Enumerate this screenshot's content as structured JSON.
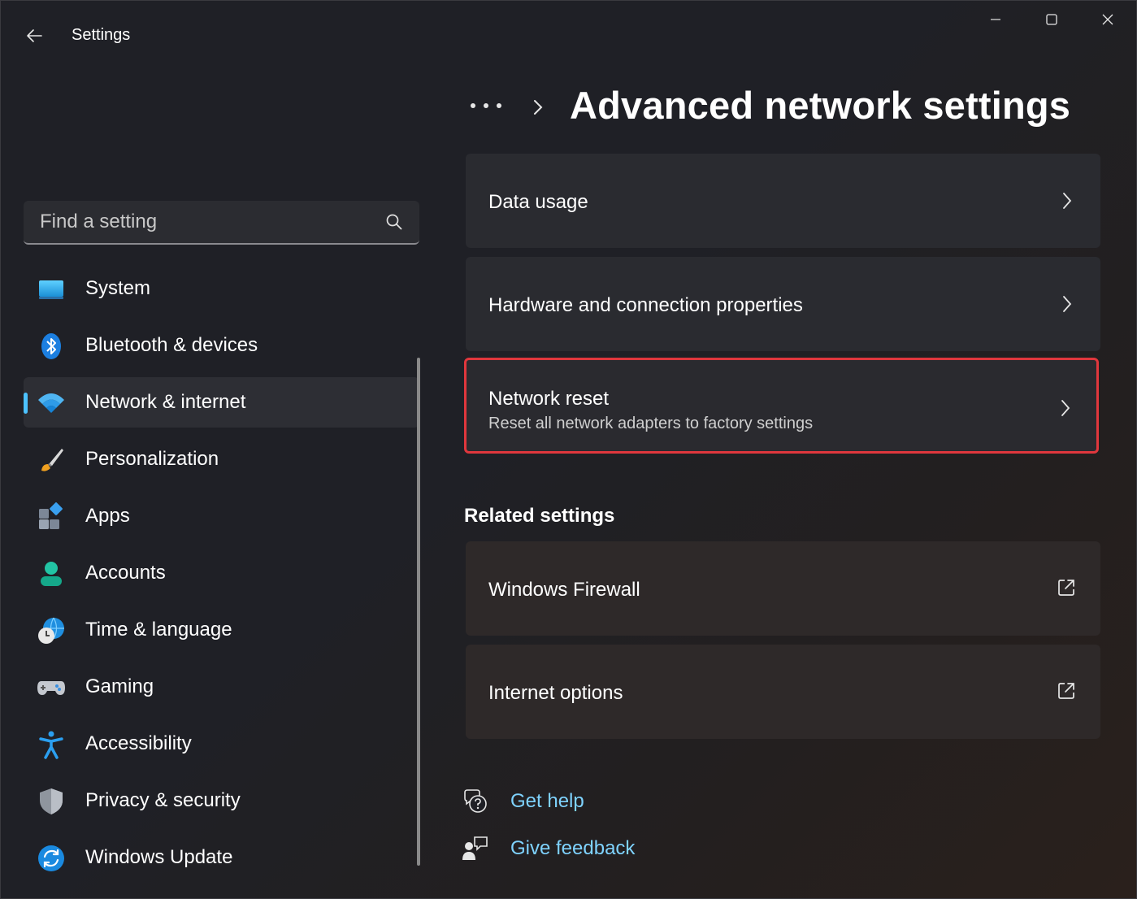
{
  "app": {
    "title": "Settings"
  },
  "search": {
    "placeholder": "Find a setting"
  },
  "nav": {
    "items": [
      {
        "label": "System",
        "icon": "system-icon"
      },
      {
        "label": "Bluetooth & devices",
        "icon": "bluetooth-icon"
      },
      {
        "label": "Network & internet",
        "icon": "wifi-icon",
        "active": true
      },
      {
        "label": "Personalization",
        "icon": "brush-icon"
      },
      {
        "label": "Apps",
        "icon": "apps-icon"
      },
      {
        "label": "Accounts",
        "icon": "accounts-icon"
      },
      {
        "label": "Time & language",
        "icon": "time-language-icon"
      },
      {
        "label": "Gaming",
        "icon": "gamepad-icon"
      },
      {
        "label": "Accessibility",
        "icon": "accessibility-icon"
      },
      {
        "label": "Privacy & security",
        "icon": "shield-icon"
      },
      {
        "label": "Windows Update",
        "icon": "update-icon"
      }
    ]
  },
  "header": {
    "title": "Advanced network settings"
  },
  "cards": {
    "data_usage": {
      "title": "Data usage"
    },
    "hardware": {
      "title": "Hardware and connection properties"
    },
    "network_reset": {
      "title": "Network reset",
      "subtitle": "Reset all network adapters to factory settings"
    }
  },
  "related": {
    "heading": "Related settings",
    "firewall": {
      "title": "Windows Firewall"
    },
    "internet_options": {
      "title": "Internet options"
    }
  },
  "help": {
    "get_help": "Get help",
    "give_feedback": "Give feedback"
  },
  "colors": {
    "accent": "#4cc2ff",
    "highlight_border": "#e0373d",
    "link": "#7fd3ff"
  }
}
